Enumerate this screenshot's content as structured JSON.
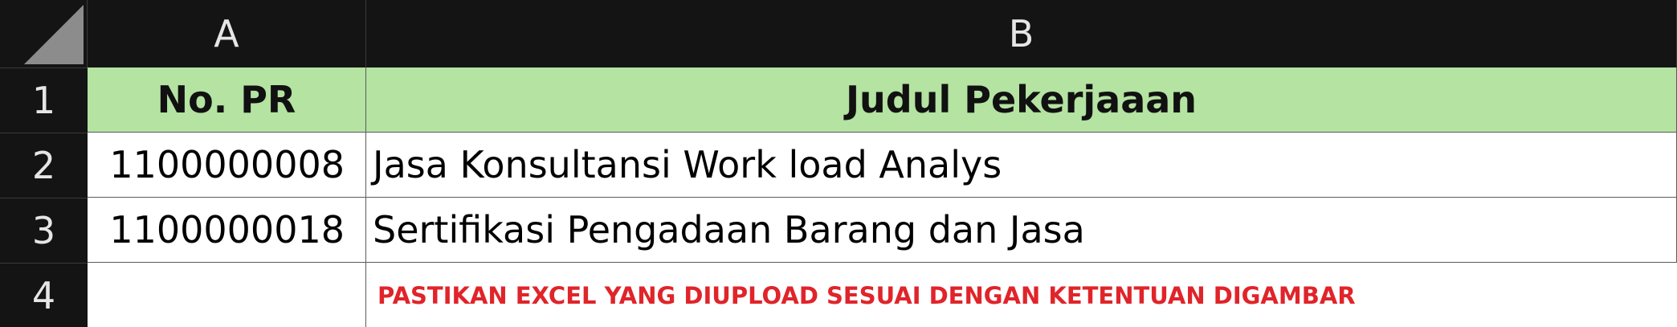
{
  "columns": [
    "A",
    "B"
  ],
  "rows": [
    "1",
    "2",
    "3",
    "4"
  ],
  "header": {
    "no_pr": "No. PR",
    "judul": "Judul Pekerjaaan"
  },
  "data_rows": [
    {
      "no_pr": "1100000008",
      "judul": "Jasa Konsultansi Work load Analys"
    },
    {
      "no_pr": "1100000018",
      "judul": "Sertifikasi Pengadaan Barang dan Jasa"
    }
  ],
  "note": "PASTIKAN EXCEL YANG DIUPLOAD SESUAI DENGAN KETENTUAN DIGAMBAR",
  "colors": {
    "header_bg": "#b4e3a2",
    "gutter_bg": "#141414",
    "note_text": "#e0242a"
  }
}
